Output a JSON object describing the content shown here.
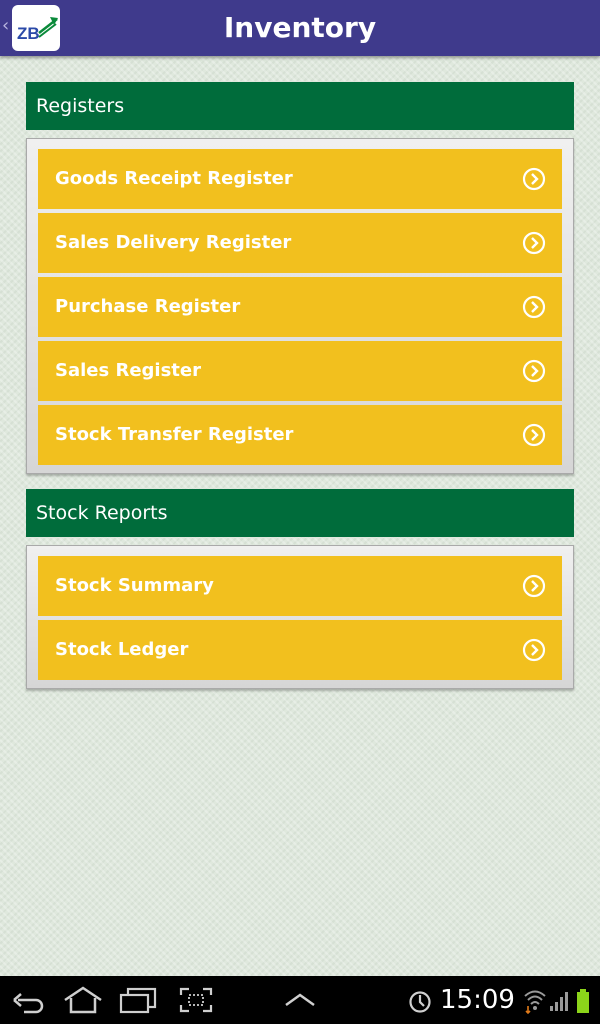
{
  "app": {
    "title": "Inventory",
    "logo_text": "ZB",
    "theme": {
      "appbar": "#3f3a8c",
      "section": "#006c3b",
      "item": "#f2c01e"
    }
  },
  "sections": [
    {
      "title": "Registers",
      "items": [
        {
          "label": "Goods Receipt Register",
          "icon": "chevron-right-circle-icon"
        },
        {
          "label": "Sales Delivery Register",
          "icon": "chevron-right-circle-icon"
        },
        {
          "label": "Purchase Register",
          "icon": "chevron-right-circle-icon"
        },
        {
          "label": "Sales Register",
          "icon": "chevron-right-circle-icon"
        },
        {
          "label": "Stock Transfer Register",
          "icon": "chevron-right-circle-icon"
        }
      ]
    },
    {
      "title": "Stock Reports",
      "items": [
        {
          "label": "Stock Summary",
          "icon": "chevron-right-circle-icon"
        },
        {
          "label": "Stock Ledger",
          "icon": "chevron-right-circle-icon"
        }
      ]
    }
  ],
  "system_bar": {
    "time": "15:09",
    "icons": [
      "back-icon",
      "home-icon",
      "recent-apps-icon",
      "screenshot-icon",
      "up-arrow-icon",
      "sync-icon",
      "wifi-icon",
      "signal-icon",
      "battery-icon"
    ]
  }
}
